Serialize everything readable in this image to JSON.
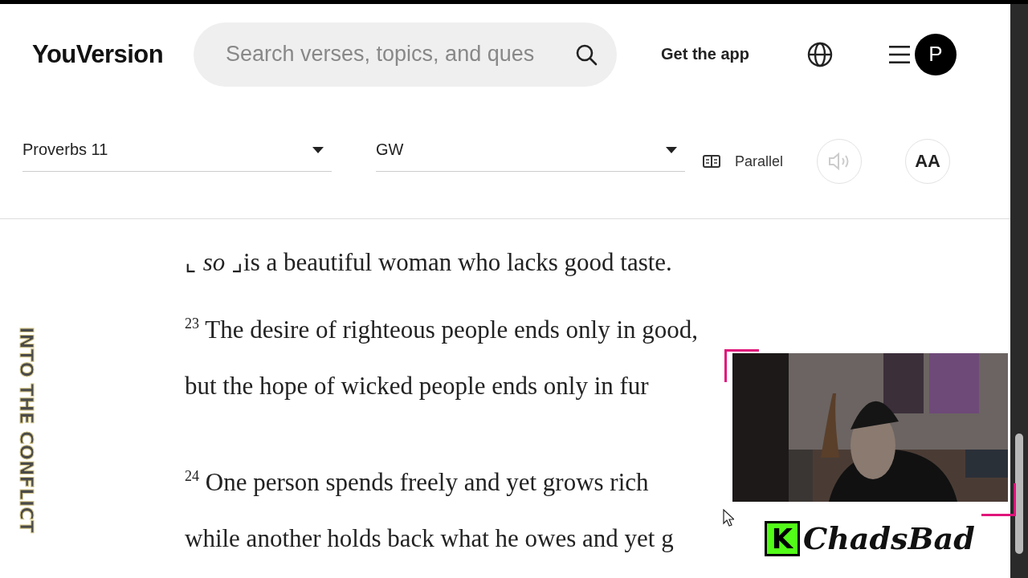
{
  "header": {
    "logo": "YouVersion",
    "search": {
      "placeholder": "Search verses, topics, and ques"
    },
    "get_app": "Get the app",
    "avatar": "P"
  },
  "toolbar": {
    "book": "Proverbs 11",
    "version": "GW",
    "parallel": "Parallel",
    "audio": {
      "disabled": true
    },
    "font_size": "AA"
  },
  "verses": [
    {
      "text": "⌞ *so* ⌟is a beautiful woman who lacks good taste."
    },
    {
      "number": "23",
      "text": "The desire of righteous people ends only in good,"
    },
    {
      "text": "but the hope of wicked people ends only in fur"
    },
    {
      "number": "24",
      "text": "One person spends freely and yet grows rich"
    },
    {
      "text": "while another holds back what he owes and yet g"
    }
  ],
  "overlay": {
    "side_title": "INTO THE CONFLICT",
    "channel": {
      "badge": "K",
      "name": "ChadsBad"
    }
  }
}
